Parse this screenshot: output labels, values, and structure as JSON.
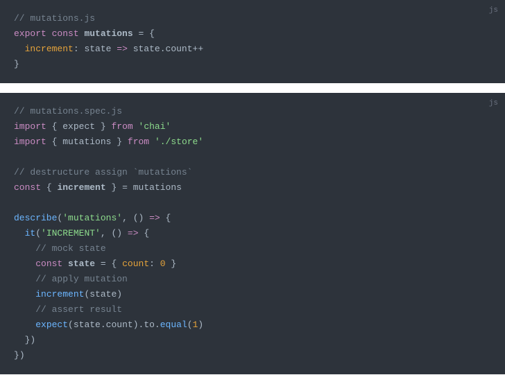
{
  "blocks": [
    {
      "lang": "js",
      "lines": [
        {
          "segments": [
            {
              "text": "// mutations.js",
              "cls": "comment"
            }
          ]
        },
        {
          "segments": [
            {
              "text": "export",
              "cls": "keyword"
            },
            {
              "text": " ",
              "cls": ""
            },
            {
              "text": "const",
              "cls": "const-keyword"
            },
            {
              "text": " ",
              "cls": ""
            },
            {
              "text": "mutations",
              "cls": "varname"
            },
            {
              "text": " ",
              "cls": ""
            },
            {
              "text": "=",
              "cls": "operator"
            },
            {
              "text": " ",
              "cls": ""
            },
            {
              "text": "{",
              "cls": "punct"
            }
          ]
        },
        {
          "segments": [
            {
              "text": "  ",
              "cls": ""
            },
            {
              "text": "increment",
              "cls": "prop"
            },
            {
              "text": ":",
              "cls": "punct"
            },
            {
              "text": " ",
              "cls": ""
            },
            {
              "text": "state",
              "cls": "param"
            },
            {
              "text": " ",
              "cls": ""
            },
            {
              "text": "=>",
              "cls": "arrow"
            },
            {
              "text": " ",
              "cls": ""
            },
            {
              "text": "state",
              "cls": "param"
            },
            {
              "text": ".",
              "cls": "punct"
            },
            {
              "text": "count",
              "cls": "param"
            },
            {
              "text": "++",
              "cls": "operator"
            }
          ]
        },
        {
          "segments": [
            {
              "text": "}",
              "cls": "punct"
            }
          ]
        }
      ]
    },
    {
      "lang": "js",
      "lines": [
        {
          "segments": [
            {
              "text": "// mutations.spec.js",
              "cls": "comment"
            }
          ]
        },
        {
          "segments": [
            {
              "text": "import",
              "cls": "keyword"
            },
            {
              "text": " ",
              "cls": ""
            },
            {
              "text": "{",
              "cls": "punct"
            },
            {
              "text": " ",
              "cls": ""
            },
            {
              "text": "expect",
              "cls": "param"
            },
            {
              "text": " ",
              "cls": ""
            },
            {
              "text": "}",
              "cls": "punct"
            },
            {
              "text": " ",
              "cls": ""
            },
            {
              "text": "from",
              "cls": "keyword"
            },
            {
              "text": " ",
              "cls": ""
            },
            {
              "text": "'chai'",
              "cls": "string"
            }
          ]
        },
        {
          "segments": [
            {
              "text": "import",
              "cls": "keyword"
            },
            {
              "text": " ",
              "cls": ""
            },
            {
              "text": "{",
              "cls": "punct"
            },
            {
              "text": " ",
              "cls": ""
            },
            {
              "text": "mutations",
              "cls": "param"
            },
            {
              "text": " ",
              "cls": ""
            },
            {
              "text": "}",
              "cls": "punct"
            },
            {
              "text": " ",
              "cls": ""
            },
            {
              "text": "from",
              "cls": "keyword"
            },
            {
              "text": " ",
              "cls": ""
            },
            {
              "text": "'./store'",
              "cls": "string"
            }
          ]
        },
        {
          "segments": [
            {
              "text": " ",
              "cls": ""
            }
          ]
        },
        {
          "segments": [
            {
              "text": "// destructure assign `mutations`",
              "cls": "comment"
            }
          ]
        },
        {
          "segments": [
            {
              "text": "const",
              "cls": "const-keyword"
            },
            {
              "text": " ",
              "cls": ""
            },
            {
              "text": "{",
              "cls": "punct"
            },
            {
              "text": " ",
              "cls": ""
            },
            {
              "text": "increment",
              "cls": "varname"
            },
            {
              "text": " ",
              "cls": ""
            },
            {
              "text": "}",
              "cls": "punct"
            },
            {
              "text": " ",
              "cls": ""
            },
            {
              "text": "=",
              "cls": "operator"
            },
            {
              "text": " ",
              "cls": ""
            },
            {
              "text": "mutations",
              "cls": "param"
            }
          ]
        },
        {
          "segments": [
            {
              "text": " ",
              "cls": ""
            }
          ]
        },
        {
          "segments": [
            {
              "text": "describe",
              "cls": "func"
            },
            {
              "text": "(",
              "cls": "punct"
            },
            {
              "text": "'mutations'",
              "cls": "string"
            },
            {
              "text": ",",
              "cls": "punct"
            },
            {
              "text": " ",
              "cls": ""
            },
            {
              "text": "(",
              "cls": "punct"
            },
            {
              "text": ")",
              "cls": "punct"
            },
            {
              "text": " ",
              "cls": ""
            },
            {
              "text": "=>",
              "cls": "arrow"
            },
            {
              "text": " ",
              "cls": ""
            },
            {
              "text": "{",
              "cls": "punct"
            }
          ]
        },
        {
          "segments": [
            {
              "text": "  ",
              "cls": ""
            },
            {
              "text": "it",
              "cls": "func"
            },
            {
              "text": "(",
              "cls": "punct"
            },
            {
              "text": "'INCREMENT'",
              "cls": "string"
            },
            {
              "text": ",",
              "cls": "punct"
            },
            {
              "text": " ",
              "cls": ""
            },
            {
              "text": "(",
              "cls": "punct"
            },
            {
              "text": ")",
              "cls": "punct"
            },
            {
              "text": " ",
              "cls": ""
            },
            {
              "text": "=>",
              "cls": "arrow"
            },
            {
              "text": " ",
              "cls": ""
            },
            {
              "text": "{",
              "cls": "punct"
            }
          ]
        },
        {
          "segments": [
            {
              "text": "    ",
              "cls": ""
            },
            {
              "text": "// mock state",
              "cls": "comment"
            }
          ]
        },
        {
          "segments": [
            {
              "text": "    ",
              "cls": ""
            },
            {
              "text": "const",
              "cls": "const-keyword"
            },
            {
              "text": " ",
              "cls": ""
            },
            {
              "text": "state",
              "cls": "varname"
            },
            {
              "text": " ",
              "cls": ""
            },
            {
              "text": "=",
              "cls": "operator"
            },
            {
              "text": " ",
              "cls": ""
            },
            {
              "text": "{",
              "cls": "punct"
            },
            {
              "text": " ",
              "cls": ""
            },
            {
              "text": "count",
              "cls": "prop"
            },
            {
              "text": ":",
              "cls": "punct"
            },
            {
              "text": " ",
              "cls": ""
            },
            {
              "text": "0",
              "cls": "number"
            },
            {
              "text": " ",
              "cls": ""
            },
            {
              "text": "}",
              "cls": "punct"
            }
          ]
        },
        {
          "segments": [
            {
              "text": "    ",
              "cls": ""
            },
            {
              "text": "// apply mutation",
              "cls": "comment"
            }
          ]
        },
        {
          "segments": [
            {
              "text": "    ",
              "cls": ""
            },
            {
              "text": "increment",
              "cls": "func"
            },
            {
              "text": "(",
              "cls": "punct"
            },
            {
              "text": "state",
              "cls": "param"
            },
            {
              "text": ")",
              "cls": "punct"
            }
          ]
        },
        {
          "segments": [
            {
              "text": "    ",
              "cls": ""
            },
            {
              "text": "// assert result",
              "cls": "comment"
            }
          ]
        },
        {
          "segments": [
            {
              "text": "    ",
              "cls": ""
            },
            {
              "text": "expect",
              "cls": "func"
            },
            {
              "text": "(",
              "cls": "punct"
            },
            {
              "text": "state",
              "cls": "param"
            },
            {
              "text": ".",
              "cls": "punct"
            },
            {
              "text": "count",
              "cls": "param"
            },
            {
              "text": ")",
              "cls": "punct"
            },
            {
              "text": ".",
              "cls": "punct"
            },
            {
              "text": "to",
              "cls": "param"
            },
            {
              "text": ".",
              "cls": "punct"
            },
            {
              "text": "equal",
              "cls": "func"
            },
            {
              "text": "(",
              "cls": "punct"
            },
            {
              "text": "1",
              "cls": "number"
            },
            {
              "text": ")",
              "cls": "punct"
            }
          ]
        },
        {
          "segments": [
            {
              "text": "  ",
              "cls": ""
            },
            {
              "text": "}",
              "cls": "punct"
            },
            {
              "text": ")",
              "cls": "punct"
            }
          ]
        },
        {
          "segments": [
            {
              "text": "}",
              "cls": "punct"
            },
            {
              "text": ")",
              "cls": "punct"
            }
          ]
        }
      ]
    }
  ]
}
